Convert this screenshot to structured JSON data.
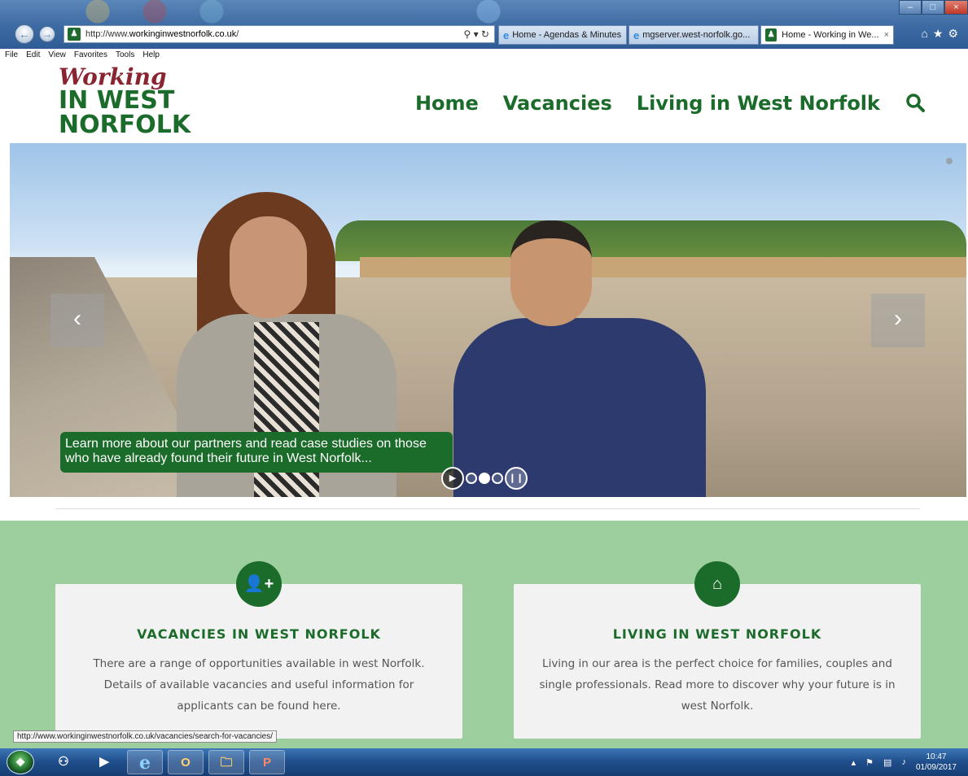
{
  "browser": {
    "address": {
      "prefix": "http://www.",
      "domain": "workinginwestnorfolk.co.uk",
      "suffix": "/"
    },
    "tabs": [
      {
        "label": "Home - Agendas & Minutes"
      },
      {
        "label": "mgserver.west-norfolk.go..."
      },
      {
        "label": "Home - Working in We..."
      }
    ],
    "menu": [
      "File",
      "Edit",
      "View",
      "Favorites",
      "Tools",
      "Help"
    ]
  },
  "site": {
    "logo": {
      "line1": "Working",
      "line2": "IN WEST",
      "line3": "NORFOLK"
    },
    "nav": [
      "Home",
      "Vacancies",
      "Living in West Norfolk"
    ],
    "hero": {
      "caption": "Learn more about our partners and read case studies on those who have already found their future in West Norfolk..."
    },
    "cards": [
      {
        "title": "VACANCIES IN WEST NORFOLK",
        "body": "There are a range of opportunities available in west Norfolk. Details of available vacancies and useful information for applicants can be found here.",
        "icon": "add-user-icon"
      },
      {
        "title": "LIVING IN WEST NORFOLK",
        "body": "Living in our area is the perfect choice for families, couples and single professionals. Read more to discover why your future is in west Norfolk.",
        "icon": "home-icon"
      }
    ],
    "colors": {
      "brand_green": "#1b6b2a",
      "logo_red": "#8a2431",
      "section_green": "#9cce9e"
    }
  },
  "status": {
    "link": "http://www.workinginwestnorfolk.co.uk/vacancies/search-for-vacancies/"
  },
  "taskbar": {
    "time": "10:47",
    "date": "01/09/2017"
  }
}
